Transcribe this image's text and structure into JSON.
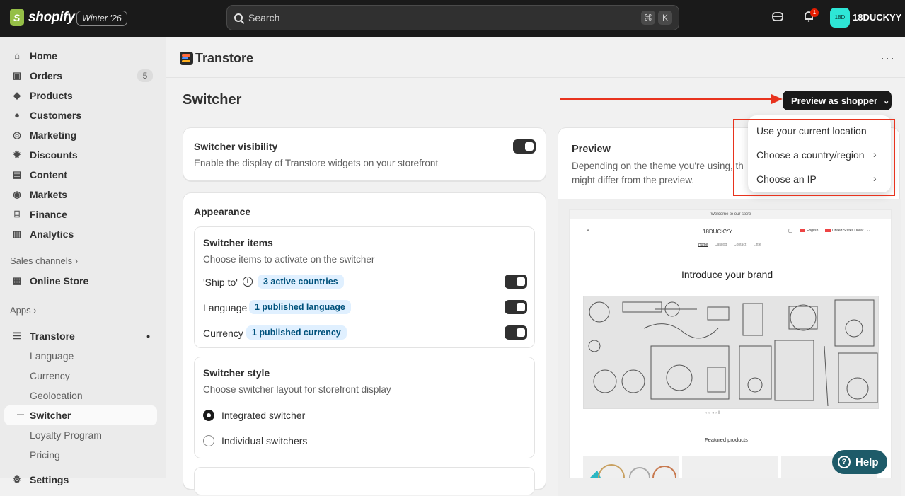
{
  "topbar": {
    "brand": "shopify",
    "edition": "Winter '26",
    "search_placeholder": "Search",
    "kbd": [
      "⌘",
      "K"
    ],
    "notification_count": "1",
    "avatar_initials": "18D",
    "store_name": "18DUCKYY"
  },
  "sidebar": {
    "items": [
      {
        "label": "Home",
        "icon": "home-icon"
      },
      {
        "label": "Orders",
        "icon": "inbox-icon",
        "badge": "5"
      },
      {
        "label": "Products",
        "icon": "tag-icon"
      },
      {
        "label": "Customers",
        "icon": "person-icon"
      },
      {
        "label": "Marketing",
        "icon": "target-icon"
      },
      {
        "label": "Discounts",
        "icon": "discount-icon"
      },
      {
        "label": "Content",
        "icon": "content-icon"
      },
      {
        "label": "Markets",
        "icon": "globe-icon"
      },
      {
        "label": "Finance",
        "icon": "bank-icon"
      },
      {
        "label": "Analytics",
        "icon": "chart-icon"
      }
    ],
    "sales_channels_label": "Sales channels",
    "online_store": "Online Store",
    "apps_label": "Apps",
    "app_name": "Transtore",
    "app_sub": [
      "Language",
      "Currency",
      "Geolocation",
      "Switcher",
      "Loyalty Program",
      "Pricing"
    ],
    "settings_partial": "Settings"
  },
  "app": {
    "title": "Transtore",
    "page_title": "Switcher",
    "preview_button": "Preview as shopper"
  },
  "dropdown": {
    "items": [
      "Use your current location",
      "Choose a country/region",
      "Choose an IP"
    ]
  },
  "visibility": {
    "title": "Switcher visibility",
    "desc": "Enable the display of Transtore widgets on your storefront"
  },
  "appearance": {
    "title": "Appearance",
    "items_title": "Switcher items",
    "items_desc": "Choose items to activate on the switcher",
    "rows": [
      {
        "label": "'Ship to'",
        "pill": "3 active countries"
      },
      {
        "label": "Language",
        "pill": "1 published language"
      },
      {
        "label": "Currency",
        "pill": "1 published currency"
      }
    ],
    "style_title": "Switcher style",
    "style_desc": "Choose switcher layout for storefront display",
    "options": [
      "Integrated switcher",
      "Individual switchers"
    ]
  },
  "preview": {
    "title": "Preview",
    "desc_line1": "Depending on the theme you're using, th",
    "desc_line2": "might differ from the preview.",
    "store": {
      "announcement": "Welcome to our store",
      "name": "18DUCKYY",
      "locale": "English",
      "currency": "United States Dollar",
      "nav": [
        "Home",
        "Catalog",
        "Contact",
        "Little"
      ],
      "hero": "Introduce your brand",
      "featured": "Featured products"
    }
  },
  "help": "Help",
  "colors": {
    "accent_red": "#e8331e",
    "dark": "#1a1a1a",
    "pill_bg": "#e0f0ff"
  }
}
